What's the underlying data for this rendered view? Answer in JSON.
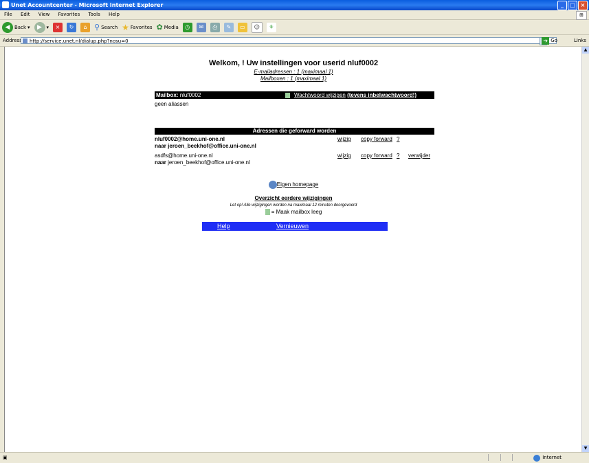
{
  "window": {
    "title": "Unet Accountcenter - Microsoft Internet Explorer"
  },
  "menu": [
    "File",
    "Edit",
    "View",
    "Favorites",
    "Tools",
    "Help"
  ],
  "toolbar": {
    "back": "Back",
    "search": "Search",
    "favorites": "Favorites",
    "media": "Media"
  },
  "address": {
    "label": "Address",
    "url": "http://service.unet.nl/dialup.php?nosu=0",
    "go": "Go",
    "links": "Links"
  },
  "page": {
    "welcome": "Welkom, ! Uw instellingen voor userid nluf0002",
    "email_addresses": "E-mailadressen : 1 (maximaal 1)",
    "mailboxes": "Mailboxen : 1 (maximaal 1)",
    "mailbox_label": "Mailbox:",
    "mailbox_id": "nluf0002",
    "change_password": "Wachtwoord wijzigen",
    "also_dialup": "(tevens inbelwachtwoord!)",
    "no_aliases": "geen aliassen",
    "forward_header": "Adressen die geforward worden",
    "forwards": [
      {
        "from": "nluf0002@home.uni-one.nl",
        "to_prefix": "naar",
        "to": "jeroen_beekhof@office.uni-one.nl",
        "edit": "wijzig",
        "copy": "copy forward",
        "help": "?",
        "delete": ""
      },
      {
        "from": "asdfs@home.uni-one.nl",
        "to_prefix": "naar",
        "to": "jeroen_beekhof@office.uni-one.nl",
        "edit": "wijzig",
        "copy": "copy forward",
        "help": "?",
        "delete": "verwijder"
      }
    ],
    "homepage": "Eigen homepage",
    "history": "Overzicht eerdere wijzigingen",
    "note": "Let op! Alle wijzigingen worden na maximaal 12 minuten doorgevoerd",
    "legend": "= Maak mailbox leeg",
    "nav": {
      "help": "Help",
      "refresh": "Vernieuwen"
    }
  },
  "status": {
    "zone": "Internet"
  }
}
